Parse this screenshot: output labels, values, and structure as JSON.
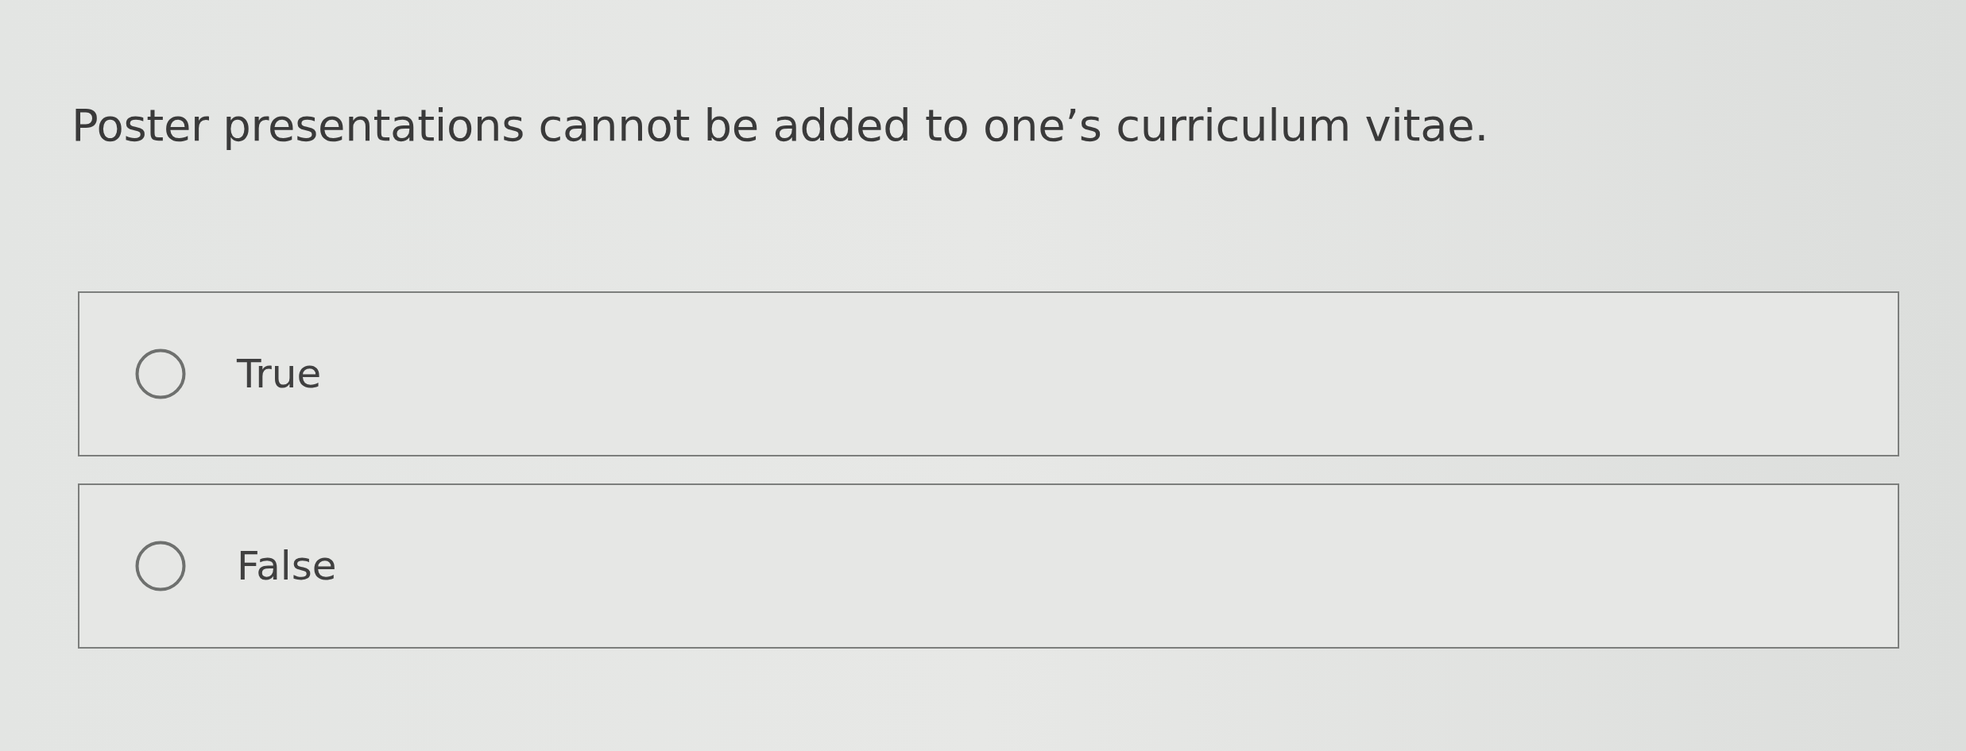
{
  "question": {
    "text": "Poster presentations cannot be added to one’s curriculum vitae."
  },
  "options": [
    {
      "label": "True",
      "selected": false
    },
    {
      "label": "False",
      "selected": false
    }
  ]
}
